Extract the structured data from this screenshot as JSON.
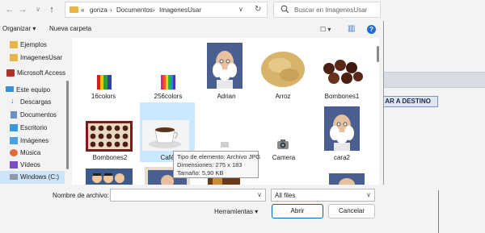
{
  "background_app": {
    "button_label": "AR A DESTINO"
  },
  "nav_buttons": {
    "back": "←",
    "forward": "→",
    "recent": "∨",
    "up": "↑"
  },
  "address": {
    "crumbs": [
      "«",
      "gonza",
      "›",
      "Documentos",
      "›",
      "ImagenesUsar"
    ],
    "dropdown": "∨",
    "refresh": "↻"
  },
  "search": {
    "placeholder": "Buscar en ImagenesUsar",
    "icon": "search-icon"
  },
  "toolbar": {
    "organize": "Organizar ▾",
    "new_folder": "Nueva carpeta",
    "view": "☐ ▾",
    "pane": "▥",
    "help": "?"
  },
  "sidebar": {
    "items": [
      {
        "label": "Ejemplos",
        "icon": "folder-icon"
      },
      {
        "label": "ImagenesUsar",
        "icon": "folder-icon"
      },
      {
        "label": "Microsoft Access",
        "icon": "access-icon"
      },
      {
        "label": "Este equipo",
        "icon": "computer-icon"
      },
      {
        "label": "Descargas",
        "icon": "download-icon"
      },
      {
        "label": "Documentos",
        "icon": "documents-icon"
      },
      {
        "label": "Escritorio",
        "icon": "desktop-icon"
      },
      {
        "label": "Imágenes",
        "icon": "pictures-icon"
      },
      {
        "label": "Música",
        "icon": "music-icon"
      },
      {
        "label": "Vídeos",
        "icon": "videos-icon"
      },
      {
        "label": "Windows (C:)",
        "icon": "drive-icon"
      }
    ]
  },
  "files": [
    {
      "name": "16colors"
    },
    {
      "name": "256colors"
    },
    {
      "name": "Adrian"
    },
    {
      "name": "Arroz"
    },
    {
      "name": "Bombones1"
    },
    {
      "name": "Bombones2"
    },
    {
      "name": "Café"
    },
    {
      "name": ""
    },
    {
      "name": "Camera"
    },
    {
      "name": "cara2"
    }
  ],
  "tooltip": {
    "line1": "Tipo de elemento: Archivo JPG",
    "line2": "Dimensiones: 275 x 183",
    "line3": "Tamaño: 5,90 KB"
  },
  "footer": {
    "filename_label": "Nombre de archivo:",
    "filename_value": "",
    "filetype": "All files",
    "tools": "Herramientas ▾",
    "open": "Abrir",
    "cancel": "Cancelar"
  }
}
